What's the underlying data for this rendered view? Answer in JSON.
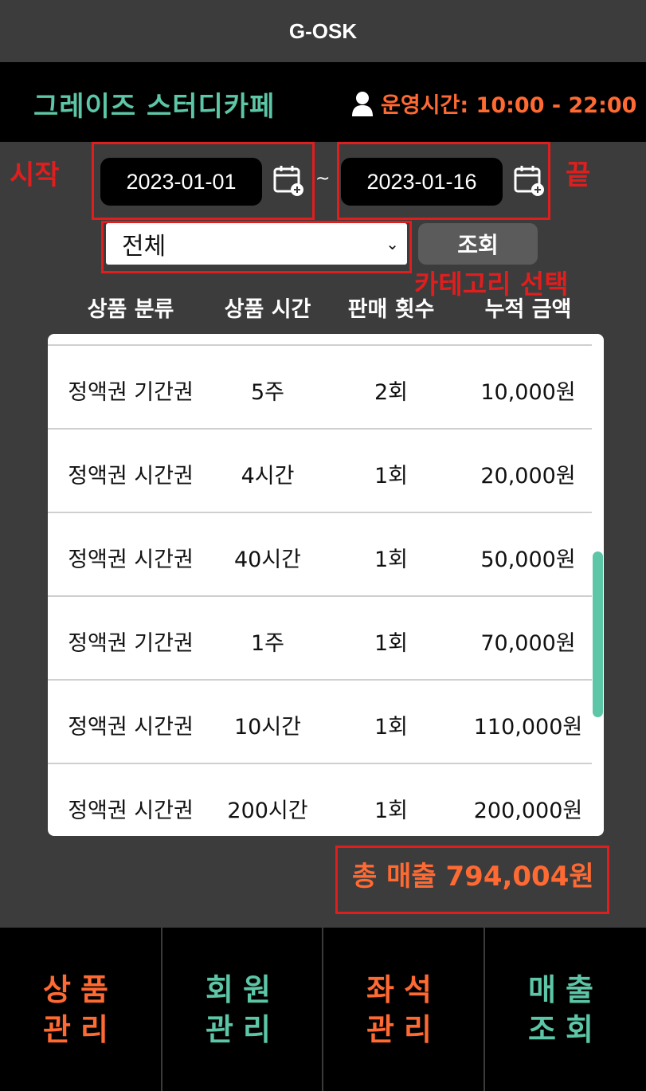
{
  "app_title": "G-OSK",
  "header": {
    "shop_name": "그레이즈 스터디카페",
    "hours_label": "운영시간: 10:00 - 22:00"
  },
  "annotations": {
    "start": "시작",
    "end": "끝",
    "category": "카테고리 선택"
  },
  "filters": {
    "start_date": "2023-01-01",
    "end_date": "2023-01-16",
    "separator": "~",
    "category_selected": "전체",
    "search_label": "조회"
  },
  "table": {
    "headers": [
      "상품 분류",
      "상품 시간",
      "판매 횟수",
      "누적 금액"
    ],
    "rows": [
      [
        "정액권 기간권",
        "5주",
        "2회",
        "10,000원"
      ],
      [
        "정액권 시간권",
        "4시간",
        "1회",
        "20,000원"
      ],
      [
        "정액권 시간권",
        "40시간",
        "1회",
        "50,000원"
      ],
      [
        "정액권 기간권",
        "1주",
        "1회",
        "70,000원"
      ],
      [
        "정액권 시간권",
        "10시간",
        "1회",
        "110,000원"
      ],
      [
        "정액권 시간권",
        "200시간",
        "1회",
        "200,000원"
      ]
    ]
  },
  "total_label": "총 매출 794,004원",
  "nav": [
    {
      "line1": "상품",
      "line2": "관리",
      "color": "#ff6a33"
    },
    {
      "line1": "회원",
      "line2": "관리",
      "color": "#5cc6a6"
    },
    {
      "line1": "좌석",
      "line2": "관리",
      "color": "#ff6a33"
    },
    {
      "line1": "매출",
      "line2": "조회",
      "color": "#5cc6a6"
    }
  ],
  "colors": {
    "accent_green": "#5cc6a6",
    "accent_orange": "#ff6a33",
    "annotation_red": "#e01e1e"
  }
}
